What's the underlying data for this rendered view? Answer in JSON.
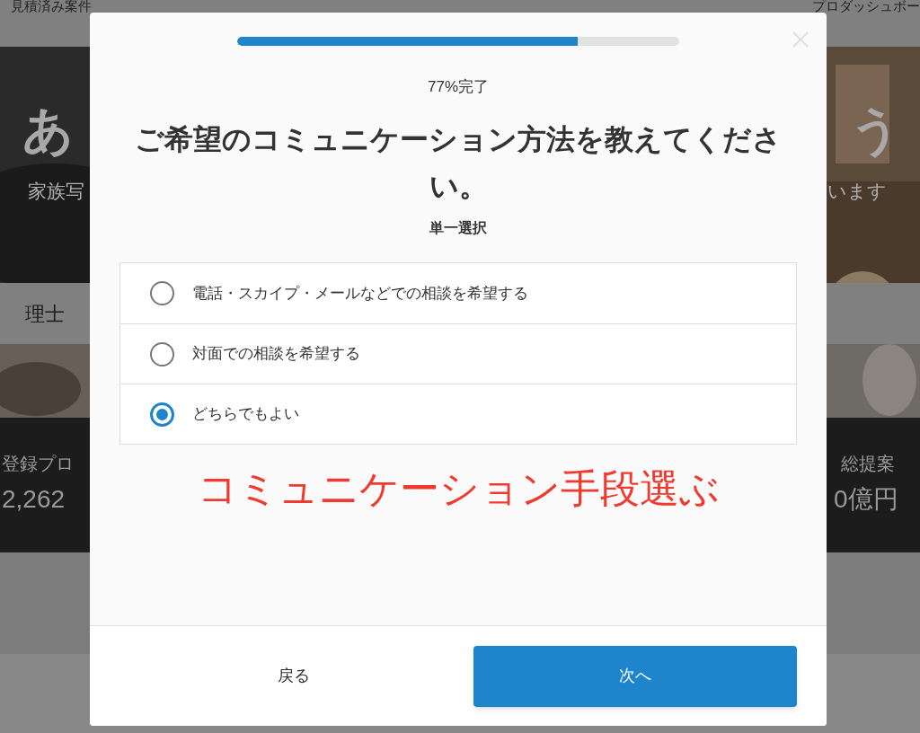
{
  "page": {
    "header": {
      "left": "見積済み案件",
      "right": "プロダッシュボー"
    },
    "hero": {
      "heading_left": "あ",
      "heading_right": "う",
      "subtitle_left": "家族写",
      "subtitle_right": "います"
    },
    "section_label": "理士",
    "stats": {
      "left_label": "登録プロ",
      "left_value": "2,262",
      "right_label": "総提案",
      "right_value": "0億円"
    }
  },
  "modal": {
    "progress": {
      "level": 0.77
    },
    "progress_text": "77%完了",
    "question": "ご希望のコミュニケーション方法を教えてください。",
    "hint": "単一選択",
    "options": [
      {
        "label": "電話・スカイプ・メールなどでの相談を希望する",
        "selected": false
      },
      {
        "label": "対面での相談を希望する",
        "selected": false
      },
      {
        "label": "どちらでもよい",
        "selected": true
      }
    ],
    "annotation": "コミュニケーション手段選ぶ",
    "back_button": "戻る",
    "next_button": "次へ"
  }
}
